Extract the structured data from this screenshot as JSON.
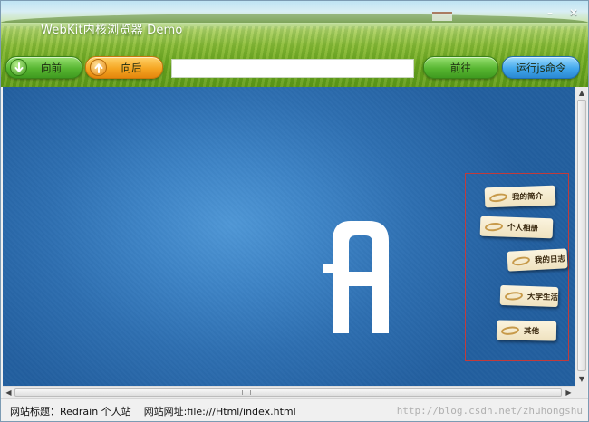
{
  "window": {
    "title": "WebKit内核浏览器 Demo",
    "minimize_glyph": "–",
    "close_glyph": "✕"
  },
  "toolbar": {
    "back_label": "向前",
    "back_icon": "arrow-down-icon",
    "forward_label": "向后",
    "forward_icon": "arrow-up-icon",
    "url_value": "",
    "go_label": "前往",
    "run_js_label": "运行js命令"
  },
  "page": {
    "menu_tags": [
      {
        "label": "我的简介"
      },
      {
        "label": "个人相册"
      },
      {
        "label": "我的日志"
      },
      {
        "label": "大学生活"
      },
      {
        "label": "其他"
      }
    ]
  },
  "statusbar": {
    "site_title_label": "网站标题：Redrain 个人站",
    "site_url_label": "网站网址:file:///Html/index.html"
  },
  "watermark": "http://blog.csdn.net/zhuhongshu",
  "colors": {
    "green_button": "#58b632",
    "orange_button": "#f5a623",
    "blue_button": "#42a8ec",
    "page_background": "#2e6fb1",
    "highlight_box": "#c23b3b"
  }
}
